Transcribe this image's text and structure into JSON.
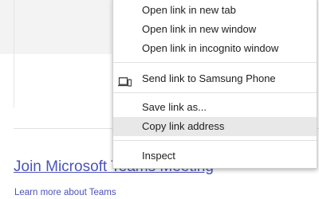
{
  "page": {
    "join_link": "Join Microsoft Teams Meeting",
    "learn_more": "Learn more about Teams"
  },
  "context_menu": {
    "items": [
      {
        "label": "Open link in new tab"
      },
      {
        "label": "Open link in new window"
      },
      {
        "label": "Open link in incognito window"
      },
      {
        "label": "Send link to Samsung Phone",
        "icon": "devices-icon"
      },
      {
        "label": "Save link as..."
      },
      {
        "label": "Copy link address",
        "highlighted": true
      },
      {
        "label": "Inspect"
      }
    ]
  },
  "colors": {
    "link": "#4b53bc",
    "menu_hover": "#e8e8e8",
    "menu_text": "#202020"
  }
}
